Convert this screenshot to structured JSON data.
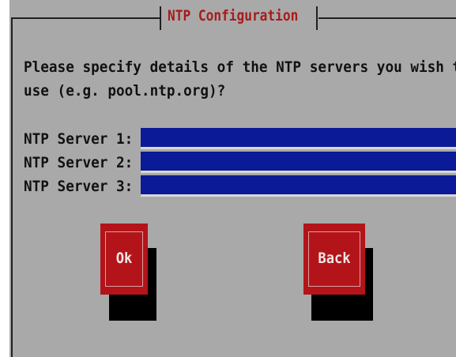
{
  "dialog": {
    "title": "NTP Configuration",
    "prompt_line1": "Please specify details of the NTP servers you wish to",
    "prompt_line2": "use (e.g. pool.ntp.org)?"
  },
  "fields": [
    {
      "label": "NTP Server 1:",
      "value": ""
    },
    {
      "label": "NTP Server 2:",
      "value": ""
    },
    {
      "label": "NTP Server 3:",
      "value": ""
    }
  ],
  "buttons": {
    "ok_label": "Ok",
    "back_label": "Back"
  },
  "colors": {
    "background": "#a9a9a9",
    "title": "#a81a1a",
    "input": "#0b1a96",
    "button": "#b3141a"
  }
}
